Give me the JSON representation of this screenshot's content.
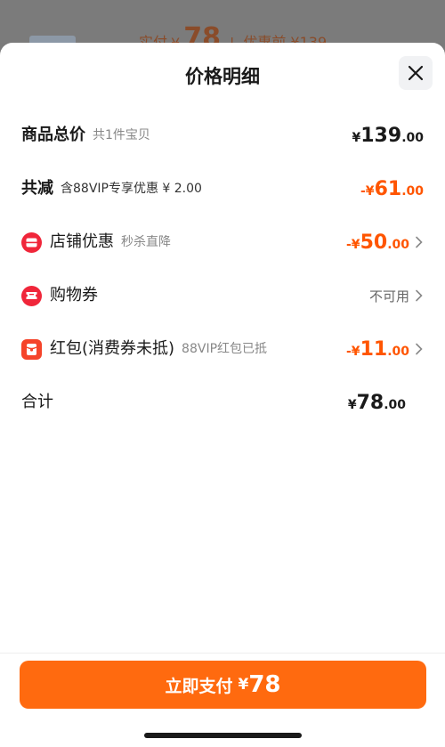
{
  "backdrop": {
    "paid_label": "实付",
    "paid_currency": "¥",
    "paid_value": "78",
    "separator": "|",
    "before_discount": "优惠前 ¥139"
  },
  "sheet": {
    "title": "价格明细",
    "close_icon": "close-icon"
  },
  "rows": {
    "total": {
      "label": "商品总价",
      "sub": "共1件宝贝",
      "currency": "¥",
      "int": "139",
      "dec": ".00"
    },
    "reduced": {
      "label": "共减",
      "sub": "含88VIP专享优惠 ¥ 2.00",
      "currency": "-¥",
      "int": "61",
      "dec": ".00"
    },
    "shop": {
      "label": "店铺优惠",
      "sub": "秒杀直降",
      "currency": "-¥",
      "int": "50",
      "dec": ".00",
      "icon": "shop-coupon-icon"
    },
    "voucher": {
      "label": "购物券",
      "value": "不可用",
      "icon": "ticket-icon"
    },
    "redpacket": {
      "label": "红包(消费券未抵)",
      "sub": "88VIP红包已抵",
      "currency": "-¥",
      "int": "11",
      "dec": ".00",
      "icon": "red-packet-icon"
    },
    "sum": {
      "label": "合计",
      "currency": "¥",
      "int": "78",
      "dec": ".00"
    }
  },
  "pay_button": {
    "label": "立即支付",
    "currency": "¥",
    "amount": "78"
  },
  "colors": {
    "accent": "#ff5500",
    "button": "#ff6a0f",
    "icon_red": "#f0263a"
  }
}
